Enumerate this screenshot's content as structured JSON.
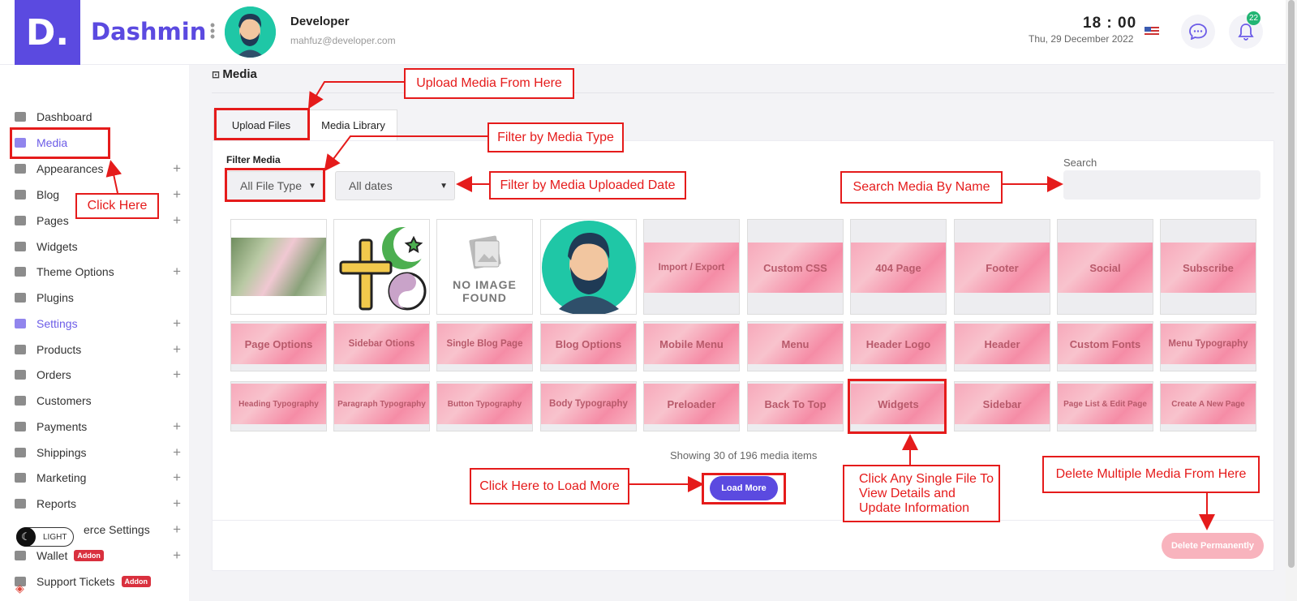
{
  "brand": {
    "logo_letter": "D.",
    "name": "Dashmin"
  },
  "user": {
    "name": "Developer",
    "email": "mahfuz@developer.com"
  },
  "clock": {
    "time": "18 : 00",
    "date": "Thu, 29 December 2022"
  },
  "notifications": {
    "count": "22"
  },
  "theme_toggle": {
    "label": "LIGHT"
  },
  "sidebar": {
    "items": [
      {
        "label": "Dashboard"
      },
      {
        "label": "Media"
      },
      {
        "label": "Appearances"
      },
      {
        "label": "Blog"
      },
      {
        "label": "Pages"
      },
      {
        "label": "Widgets"
      },
      {
        "label": "Theme Options"
      },
      {
        "label": "Plugins"
      },
      {
        "label": "Settings"
      },
      {
        "label": "Products"
      },
      {
        "label": "Orders"
      },
      {
        "label": "Customers"
      },
      {
        "label": "Payments"
      },
      {
        "label": "Shippings"
      },
      {
        "label": "Marketing"
      },
      {
        "label": "Reports"
      },
      {
        "label": "erce Settings"
      },
      {
        "label": "Wallet",
        "badge": "Addon"
      },
      {
        "label": "Support Tickets",
        "badge": "Addon"
      }
    ]
  },
  "page": {
    "title": "Media"
  },
  "tabs": {
    "upload": "Upload Files",
    "library": "Media Library"
  },
  "filters": {
    "label": "Filter Media",
    "type_value": "All File Type",
    "date_value": "All dates",
    "search_label": "Search"
  },
  "media": {
    "no_image_line1": "NO IMAGE",
    "no_image_line2": "FOUND",
    "tiles": [
      "Import / Export",
      "Custom CSS",
      "404 Page",
      "Footer",
      "Social",
      "Subscribe",
      "Page Options",
      "Sidebar Otions",
      "Single Blog Page",
      "Blog Options",
      "Mobile Menu",
      "Menu",
      "Header Logo",
      "Header",
      "Custom Fonts",
      "Menu Typography",
      "Heading Typography",
      "Paragraph Typography",
      "Button Typography",
      "Body Typography",
      "Preloader",
      "Back To Top",
      "Widgets",
      "Sidebar",
      "Page List & Edit Page",
      "Create A New Page"
    ],
    "showing": "Showing 30 of 196 media items"
  },
  "buttons": {
    "load_more": "Load More",
    "delete": "Delete Permanently"
  },
  "annotations": {
    "upload": "Upload Media From Here",
    "filter_type": "Filter by Media Type",
    "filter_date": "Filter by Media Uploaded Date",
    "search": "Search Media By Name",
    "click_here": "Click Here",
    "load_more": "Click Here to Load More",
    "single_file": "Click Any Single File To View Details and Update Information",
    "delete": "Delete Multiple Media From Here"
  },
  "colors": {
    "accent": "#5b4ae0",
    "annotation": "#e51b1b",
    "danger_light": "#f8b3bd"
  }
}
